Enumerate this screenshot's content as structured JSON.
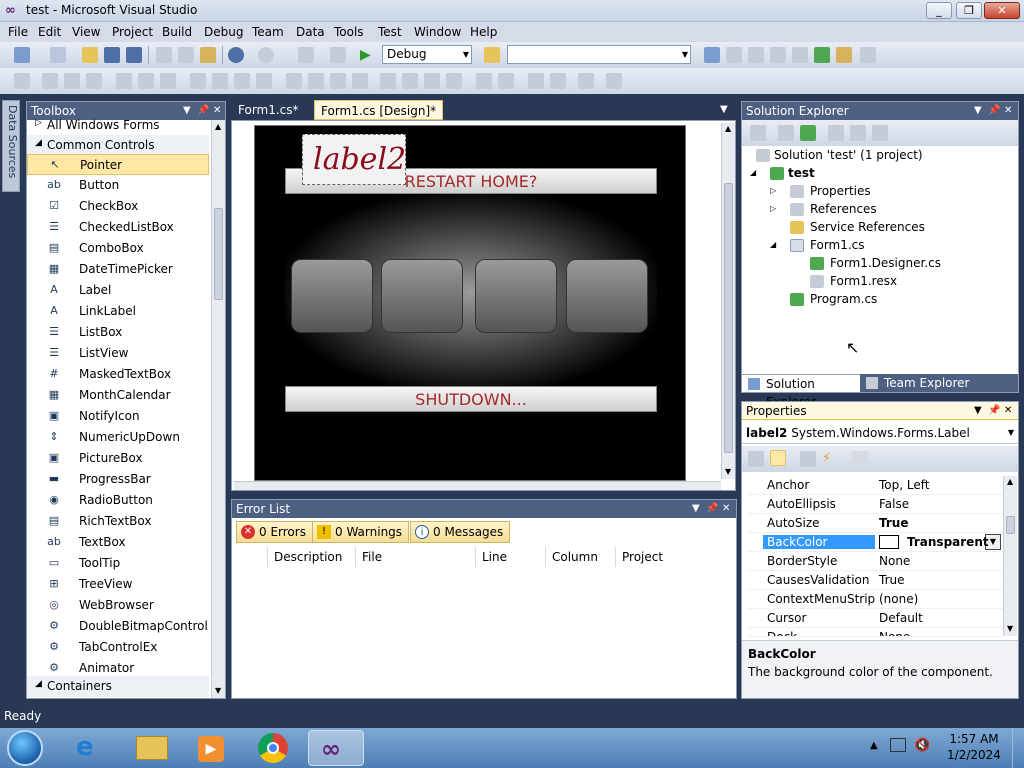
{
  "window": {
    "title": "test - Microsoft Visual Studio",
    "min": "_",
    "max": "❐",
    "close": "✕"
  },
  "menu": [
    "File",
    "Edit",
    "View",
    "Project",
    "Build",
    "Debug",
    "Team",
    "Data",
    "Tools",
    "Test",
    "Window",
    "Help"
  ],
  "toolbar": {
    "config_value": "Debug",
    "platform_value": ""
  },
  "left_strip": {
    "tab": "Data Sources"
  },
  "toolbox": {
    "title": "Toolbox",
    "group_all": "All Windows Forms",
    "group_common": "Common Controls",
    "items": [
      "Pointer",
      "Button",
      "CheckBox",
      "CheckedListBox",
      "ComboBox",
      "DateTimePicker",
      "Label",
      "LinkLabel",
      "ListBox",
      "ListView",
      "MaskedTextBox",
      "MonthCalendar",
      "NotifyIcon",
      "NumericUpDown",
      "PictureBox",
      "ProgressBar",
      "RadioButton",
      "RichTextBox",
      "TextBox",
      "ToolTip",
      "TreeView",
      "WebBrowser",
      "DoubleBitmapControl",
      "TabControlEx",
      "Animator"
    ],
    "group_containers": "Containers"
  },
  "doc_tabs": [
    "Form1.cs*",
    "Form1.cs [Design]*"
  ],
  "form": {
    "label": "label2",
    "restart": "RESTART HOME?",
    "shutdown": "SHUTDOWN..."
  },
  "errorlist": {
    "title": "Error List",
    "errors": "0 Errors",
    "warnings": "0 Warnings",
    "messages": "0 Messages",
    "columns": [
      "Description",
      "File",
      "Line",
      "Column",
      "Project"
    ]
  },
  "solution_explorer": {
    "title": "Solution Explorer",
    "nodes": [
      "Solution 'test' (1 project)",
      "test",
      "Properties",
      "References",
      "Service References",
      "Form1.cs",
      "Form1.Designer.cs",
      "Form1.resx",
      "Program.cs"
    ],
    "tab1": "Solution Explorer",
    "tab2": "Team Explorer"
  },
  "properties": {
    "title": "Properties",
    "object_name": "label2",
    "object_type": "System.Windows.Forms.Label",
    "rows": [
      {
        "name": "Anchor",
        "value": "Top, Left"
      },
      {
        "name": "AutoEllipsis",
        "value": "False"
      },
      {
        "name": "AutoSize",
        "value": "True"
      },
      {
        "name": "BackColor",
        "value": "Transparent"
      },
      {
        "name": "BorderStyle",
        "value": "None"
      },
      {
        "name": "CausesValidation",
        "value": "True"
      },
      {
        "name": "ContextMenuStrip",
        "value": "(none)"
      },
      {
        "name": "Cursor",
        "value": "Default"
      },
      {
        "name": "Dock",
        "value": "None"
      }
    ],
    "desc_title": "BackColor",
    "desc_text": "The background color of the component."
  },
  "status": "Ready",
  "clock": {
    "time": "1:57 AM",
    "date": "1/2/2024"
  },
  "colors": {
    "accent": "#293955",
    "selected_row": "#3399ff",
    "pointer_highlight": "#ffe8a6"
  }
}
